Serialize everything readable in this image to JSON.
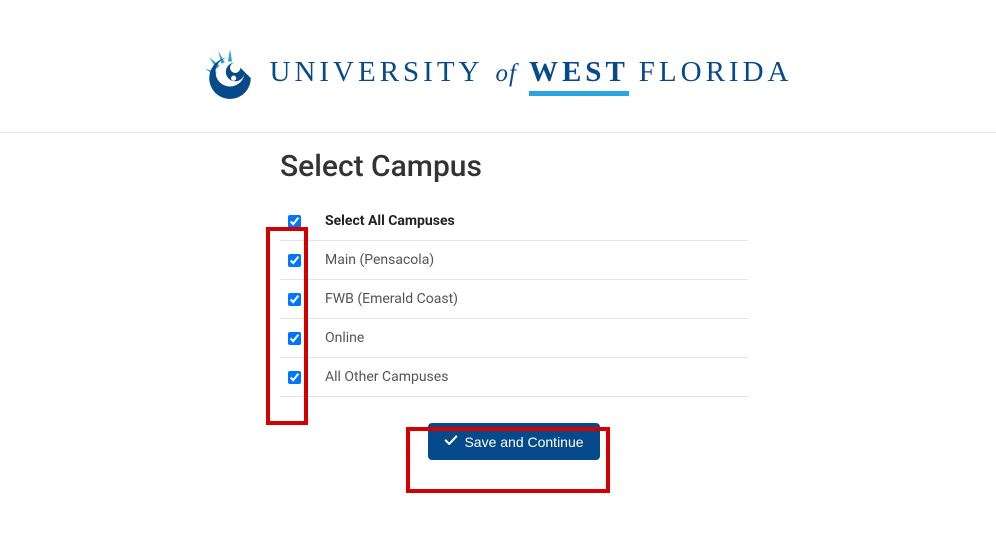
{
  "brand": {
    "part_university": "UNIVERSITY",
    "part_of": "of",
    "part_west": "WEST",
    "part_florida": "FLORIDA"
  },
  "page": {
    "title": "Select Campus"
  },
  "campuses": {
    "select_all_label": "Select All Campuses",
    "items": [
      {
        "label": "Main (Pensacola)"
      },
      {
        "label": "FWB (Emerald Coast)"
      },
      {
        "label": "Online"
      },
      {
        "label": "All Other Campuses"
      }
    ]
  },
  "actions": {
    "save_label": "Save and Continue"
  },
  "colors": {
    "brand_primary": "#074a8b",
    "brand_accent": "#29a6df",
    "highlight": "#d40000"
  }
}
